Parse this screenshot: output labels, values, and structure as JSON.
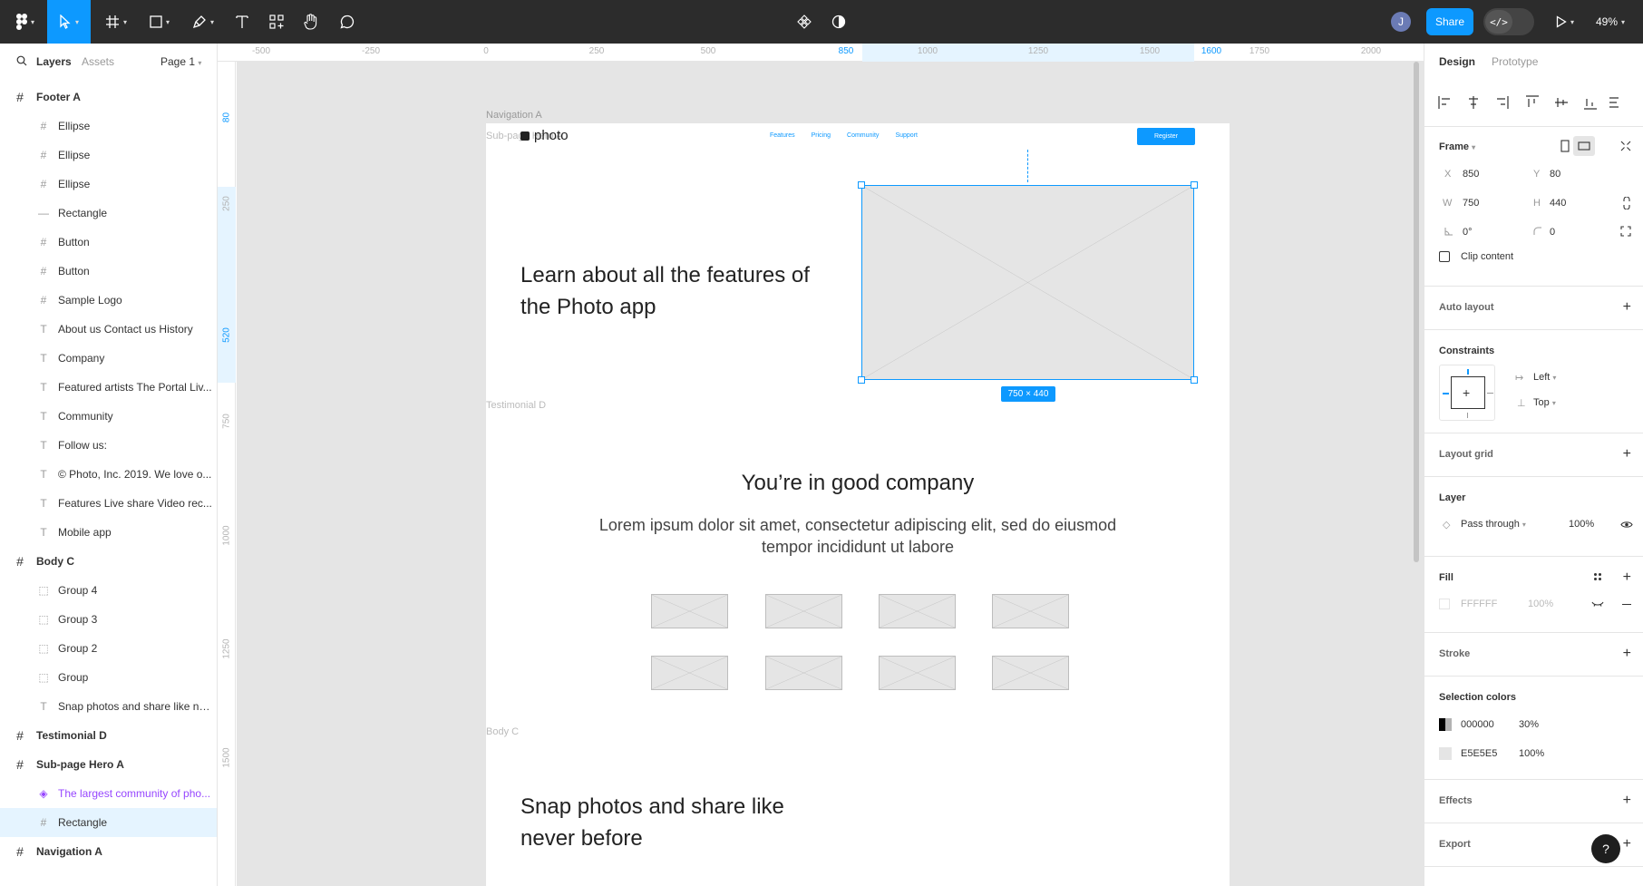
{
  "toolbar": {
    "zoom": "49%",
    "share_label": "Share",
    "avatar_initial": "J",
    "dev_mode_label": "</>"
  },
  "left_panel": {
    "tabs": {
      "layers": "Layers",
      "assets": "Assets",
      "page": "Page 1"
    },
    "layers": [
      {
        "name": "Footer A",
        "type": "frame",
        "level": 0
      },
      {
        "name": "Ellipse",
        "type": "frame",
        "level": 1
      },
      {
        "name": "Ellipse",
        "type": "frame",
        "level": 1
      },
      {
        "name": "Ellipse",
        "type": "frame",
        "level": 1
      },
      {
        "name": "Rectangle",
        "type": "line",
        "level": 1
      },
      {
        "name": "Button",
        "type": "frame",
        "level": 1
      },
      {
        "name": "Button",
        "type": "frame",
        "level": 1
      },
      {
        "name": "Sample Logo",
        "type": "frame",
        "level": 1
      },
      {
        "name": "About us Contact us History",
        "type": "text",
        "level": 1
      },
      {
        "name": "Company",
        "type": "text",
        "level": 1
      },
      {
        "name": "Featured artists The Portal Liv...",
        "type": "text",
        "level": 1
      },
      {
        "name": "Community",
        "type": "text",
        "level": 1
      },
      {
        "name": "Follow us:",
        "type": "text",
        "level": 1
      },
      {
        "name": "© Photo, Inc. 2019. We love o...",
        "type": "text",
        "level": 1
      },
      {
        "name": "Features Live share Video rec...",
        "type": "text",
        "level": 1
      },
      {
        "name": "Mobile app",
        "type": "text",
        "level": 1
      },
      {
        "name": "Body C",
        "type": "frame",
        "level": 0
      },
      {
        "name": "Group 4",
        "type": "group",
        "level": 1
      },
      {
        "name": "Group 3",
        "type": "group",
        "level": 1
      },
      {
        "name": "Group 2",
        "type": "group",
        "level": 1
      },
      {
        "name": "Group",
        "type": "group",
        "level": 1
      },
      {
        "name": "Snap photos and share like ne...",
        "type": "text",
        "level": 1
      },
      {
        "name": "Testimonial D",
        "type": "frame",
        "level": 0
      },
      {
        "name": "Sub-page Hero A",
        "type": "frame",
        "level": 0
      },
      {
        "name": "The largest community of pho...",
        "type": "component",
        "level": 1
      },
      {
        "name": "Rectangle",
        "type": "frame",
        "level": 1,
        "selected": true
      },
      {
        "name": "Navigation A",
        "type": "frame",
        "level": 0
      }
    ]
  },
  "rulers": {
    "top": [
      "-500",
      "-250",
      "0",
      "250",
      "500",
      "850",
      "1000",
      "1250",
      "1500",
      "1600",
      "1750",
      "2000"
    ],
    "left": [
      "80",
      "250",
      "520",
      "750",
      "1000",
      "1250",
      "1500"
    ]
  },
  "canvas": {
    "frame_labels": {
      "nav": "Navigation A",
      "hero": "Sub-page Hero A",
      "testimonial": "Testimonial D",
      "body": "Body C"
    },
    "nav": {
      "logo": "photo",
      "links": [
        "Features",
        "Pricing",
        "Community",
        "Support"
      ],
      "register": "Register"
    },
    "hero_heading": "Learn about all the features of the Photo app",
    "selection_size": "750 × 440",
    "testimonial": {
      "heading": "You’re in good company",
      "body": "Lorem ipsum dolor sit amet, consectetur adipiscing elit, sed do eiusmod tempor incididunt ut labore"
    },
    "body_heading": "Snap photos and share like never before"
  },
  "right_panel": {
    "tabs": {
      "design": "Design",
      "prototype": "Prototype"
    },
    "frame_label": "Frame",
    "x_label": "X",
    "x": "850",
    "y_label": "Y",
    "y": "80",
    "w_label": "W",
    "w": "750",
    "h_label": "H",
    "h": "440",
    "rotation": "0°",
    "radius": "0",
    "clip_content": "Clip content",
    "auto_layout": "Auto layout",
    "constraints": "Constraints",
    "constraint_h": "Left",
    "constraint_v": "Top",
    "layout_grid": "Layout grid",
    "layer": "Layer",
    "blend": "Pass through",
    "opacity": "100%",
    "fill": "Fill",
    "fill_hex": "FFFFFF",
    "fill_opacity": "100%",
    "stroke": "Stroke",
    "selection_colors": "Selection colors",
    "colors": [
      {
        "hex": "000000",
        "opacity": "30%"
      },
      {
        "hex": "E5E5E5",
        "opacity": "100%"
      }
    ],
    "effects": "Effects",
    "export": "Export",
    "help": "?"
  },
  "colors": {
    "accent": "#0d99ff",
    "toolbar_bg": "#2c2c2c",
    "component": "#9747ff",
    "canvas_bg": "#e5e5e5"
  }
}
